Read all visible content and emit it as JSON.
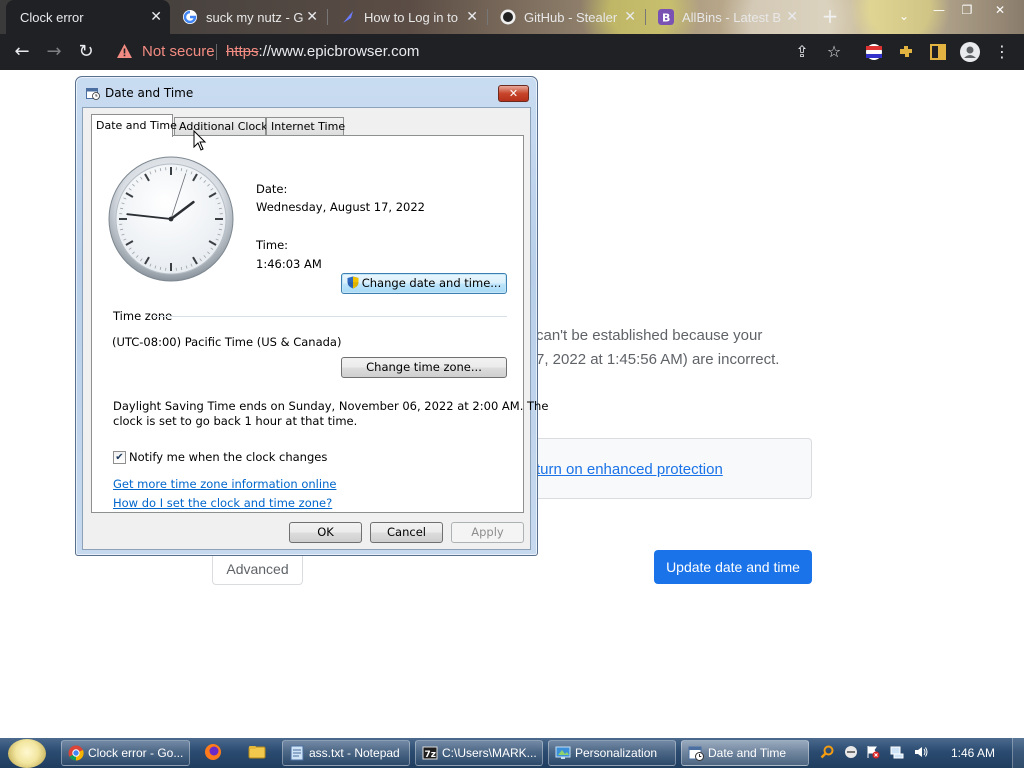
{
  "browser": {
    "tabs": [
      {
        "title": "Clock error",
        "active": true
      },
      {
        "title": "suck my nutz - G",
        "active": false
      },
      {
        "title": "How to Log in to",
        "active": false
      },
      {
        "title": "GitHub - Stealer",
        "active": false
      },
      {
        "title": "AllBins - Latest B",
        "active": false
      }
    ],
    "new_tab": "+",
    "security_label": "Not secure",
    "url_scheme": "https",
    "url_rest": "://www.epicbrowser.com",
    "accent": "#1a73e8",
    "warning_color": "#f28b82"
  },
  "page": {
    "explanation_line1": "can't be established because your",
    "explanation_line2": "7, 2022 at 1:45:56 AM) are incorrect.",
    "protection_link": "turn on enhanced protection",
    "advanced_label": "Advanced",
    "update_label": "Update date and time"
  },
  "dialog": {
    "title": "Date and Time",
    "tabs": [
      "Date and Time",
      "Additional Clocks",
      "Internet Time"
    ],
    "date_label": "Date:",
    "date_value": "Wednesday, August 17, 2022",
    "time_label": "Time:",
    "time_value": "1:46:03 AM",
    "change_datetime": "Change date and time...",
    "timezone_heading": "Time zone",
    "timezone_value": "(UTC-08:00) Pacific Time (US & Canada)",
    "change_timezone": "Change time zone...",
    "dst_line1": "Daylight Saving Time ends on Sunday, November 06, 2022 at 2:00 AM. The",
    "dst_line2": "clock is set to go back 1 hour at that time.",
    "notify_label": "Notify me when the clock changes",
    "notify_checked": true,
    "link_more_info": "Get more time zone information online",
    "link_howto": "How do I set the clock and time zone?",
    "ok": "OK",
    "cancel": "Cancel",
    "apply": "Apply",
    "clock": {
      "hours": 1,
      "minutes": 46,
      "seconds": 3
    }
  },
  "taskbar": {
    "buttons": [
      {
        "label": "Clock error - Go...",
        "icon": "chrome-icon"
      },
      {
        "label": "ass.txt - Notepad",
        "icon": "notepad-icon"
      },
      {
        "label": "C:\\Users\\MARK...",
        "icon": "7zip-icon"
      },
      {
        "label": "Personalization",
        "icon": "personalization-icon"
      },
      {
        "label": "Date and Time",
        "icon": "datetime-icon"
      }
    ],
    "clock": "1:46 AM"
  }
}
